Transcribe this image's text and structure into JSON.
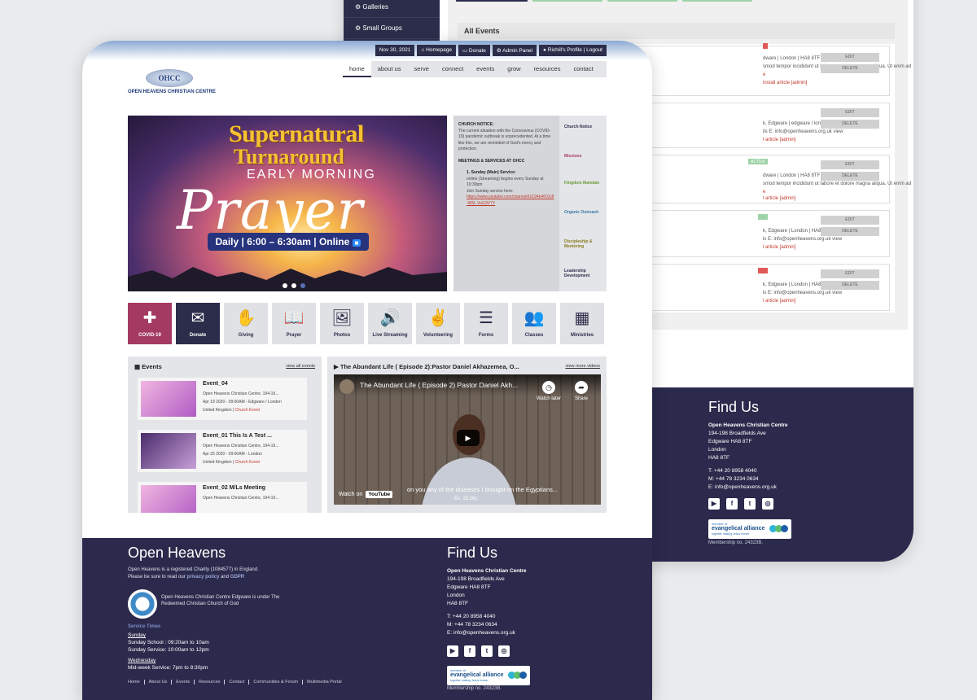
{
  "admin": {
    "sidebar": [
      "Galleries",
      "Small Groups"
    ],
    "events_title": "All Events",
    "cards": [
      {
        "line1": "dware | London | HA8 8TF",
        "line2": "smod tempor incididunt ut labore et dolore magna aliqua. Ut enim ad",
        "line3": "e",
        "line4": "install article [admin]",
        "tag": ""
      },
      {
        "line1": "k, Edgware | edgware / london | Ha8 8ql",
        "line2": "ils E: info@openheavens.org.uk view",
        "line3": "",
        "line4": "l article [admin]",
        "tag": ""
      },
      {
        "line1": "dware | London | HA8 8TF",
        "line2": "smod tempor incididunt ut labore et dolore magna aliqua. Ut enim ad",
        "line3": "e",
        "line4": "l article [admin]",
        "tag": "ACTIVE"
      },
      {
        "line1": "k, Edgware | London | HA8 8QL",
        "line2": "ls E: info@openheavens.org.uk view",
        "line3": "",
        "line4": "l article [admin]",
        "tag": ""
      },
      {
        "line1": "k, Edgware | London | HA8 8TF",
        "line2": "ls E: info@openheavens.org.uk view",
        "line3": "",
        "line4": "l article [admin]",
        "tag": ""
      }
    ],
    "edit_label": "EDIT",
    "delete_label": "DELETE",
    "footer": {
      "title": "Find Us",
      "org": "Open Heavens Christian Centre",
      "addr": [
        "194-198 Broadfields Ave",
        "Edgware HA8 8TF",
        "London",
        "HA8 8TF"
      ],
      "contact": [
        "T: +44 20 8958 4040",
        "M: +44 78 3234 0634",
        "E: info@openheavens.org.uk"
      ],
      "membership": "Membership no. 24323B."
    }
  },
  "site": {
    "util": {
      "date": "Nov 30, 2021",
      "homepage": "Homepage",
      "donate": "Donate",
      "admin": "Admin Panel",
      "profile": "Richill's Profile | Logout"
    },
    "nav": [
      "home",
      "about us",
      "serve",
      "connect",
      "events",
      "grow",
      "resources",
      "contact"
    ],
    "logo": {
      "abbr": "OHCC",
      "name": "OPEN HEAVENS CHRISTIAN CENTRE"
    },
    "hero": {
      "line1": "Supernatural",
      "line2": "Turnaround",
      "line3": "EARLY MORNING",
      "line4": "Prayer",
      "pill": "Daily | 6:00 – 6:30am | Online"
    },
    "notice": {
      "heading": "CHURCH NOTICE:",
      "text": "The current situation with the Coronavirus (COVID-19) pandemic outbreak is unprecedented. At a time like this, we are reminded of God's mercy and protection.",
      "heading2": "MEETINGS & SERVICES AT OHCC",
      "item_title": "Sunday (Main) Service:",
      "item_text": "online (Streaming) begins every Sunday at 10:30pm",
      "join": "Join Sunday service here:",
      "link": "https://www.youtube.com/channel/UC94b4fC0c8-W5L VuG3V7Y",
      "tabs": [
        "Church Notice",
        "Missions",
        "Kingdom Mandate",
        "Organic Outreach",
        "Discipleship & Mentoring",
        "Leadership Development"
      ]
    },
    "tiles": [
      {
        "label": "COVID-19",
        "icon": "plus-circle-icon",
        "glyph": "✚"
      },
      {
        "label": "Donate",
        "icon": "envelope-icon",
        "glyph": "✉"
      },
      {
        "label": "Giving",
        "icon": "hands-icon",
        "glyph": "✋"
      },
      {
        "label": "Prayer",
        "icon": "book-icon",
        "glyph": "📖"
      },
      {
        "label": "Photos",
        "icon": "image-icon",
        "glyph": "🖼"
      },
      {
        "label": "Live Streaming",
        "icon": "volume-icon",
        "glyph": "🔊"
      },
      {
        "label": "Volunteering",
        "icon": "sign-language-icon",
        "glyph": "✌"
      },
      {
        "label": "Forms",
        "icon": "form-icon",
        "glyph": "☰"
      },
      {
        "label": "Classes",
        "icon": "users-icon",
        "glyph": "👥"
      },
      {
        "label": "Ministries",
        "icon": "building-icon",
        "glyph": "▦"
      }
    ],
    "events": {
      "heading": "Events",
      "link": "view all events",
      "items": [
        {
          "title": "Event_04",
          "l1": "Open Heavens Christian Centre, 194-19...",
          "l2": "Apr 19 2020 - 09:00AM - Edgware / London",
          "l3": "United Kingdom | ",
          "cat": "Church Event"
        },
        {
          "title": "Event_01 This Is A Test ...",
          "l1": "Open Heavens Christian Centre, 194-19...",
          "l2": "Apr 25 2020 - 09:00AM - London",
          "l3": "United Kingdom | ",
          "cat": "Church Event"
        },
        {
          "title": "Event_02 M/Ls Meeting",
          "l1": "Open Heavens Christian Centre, 194-19...",
          "l2": "",
          "l3": "",
          "cat": ""
        }
      ]
    },
    "video": {
      "heading": "The Abundant Life ( Episode 2):Pastor Daniel Akhazemea, O...",
      "link": "view more videos",
      "title": "The Abundant Life ( Episode 2) Pastor Daniel Akh...",
      "watch_later": "Watch later",
      "share": "Share",
      "watch_on": "Watch on",
      "youtube": "YouTube",
      "subtitle": "on you any of the diseases I brought on the Egyptians...",
      "subref": "Ex. 15:26c"
    },
    "footer": {
      "title": "Open Heavens",
      "p1": "Open Heavens is a registered Charity (1084577) in England.",
      "p2a": "Please be sure to read our ",
      "privacy": "privacy policy",
      "and": " and ",
      "gdpr": "GDPR",
      "p3": "Open Heavens Christian Centre Edgware is under The",
      "p4": "Redeemed Christian Church of God",
      "times_title": "Service Times",
      "sunday": "Sunday",
      "s1": "Sunday School : 09:20am to 10am",
      "s2": "Sunday Service: 10:00am to 12pm",
      "wednesday": "Wednesday",
      "w1": "Mid-week Service: 7pm to 8:30pm",
      "links": [
        "Home",
        "About Us",
        "Events",
        "Resources",
        "Contact",
        "Communities & Forum",
        "Multimedia Portal"
      ],
      "find": "Find Us",
      "org": "Open Heavens Christian Centre",
      "addr": [
        "194-198 Broadfields Ave",
        "Edgware HA8 8TF",
        "London",
        "HA8 8TF"
      ],
      "contact": [
        "T: +44 20 8958 4040",
        "M: +44 78 3234 0634",
        "E: info@openheavens.org.uk"
      ],
      "ea1": "member of",
      "ea2": "evangelical alliance",
      "ea3": "together making Jesus known",
      "membership": "Membership no. 24323B."
    }
  }
}
